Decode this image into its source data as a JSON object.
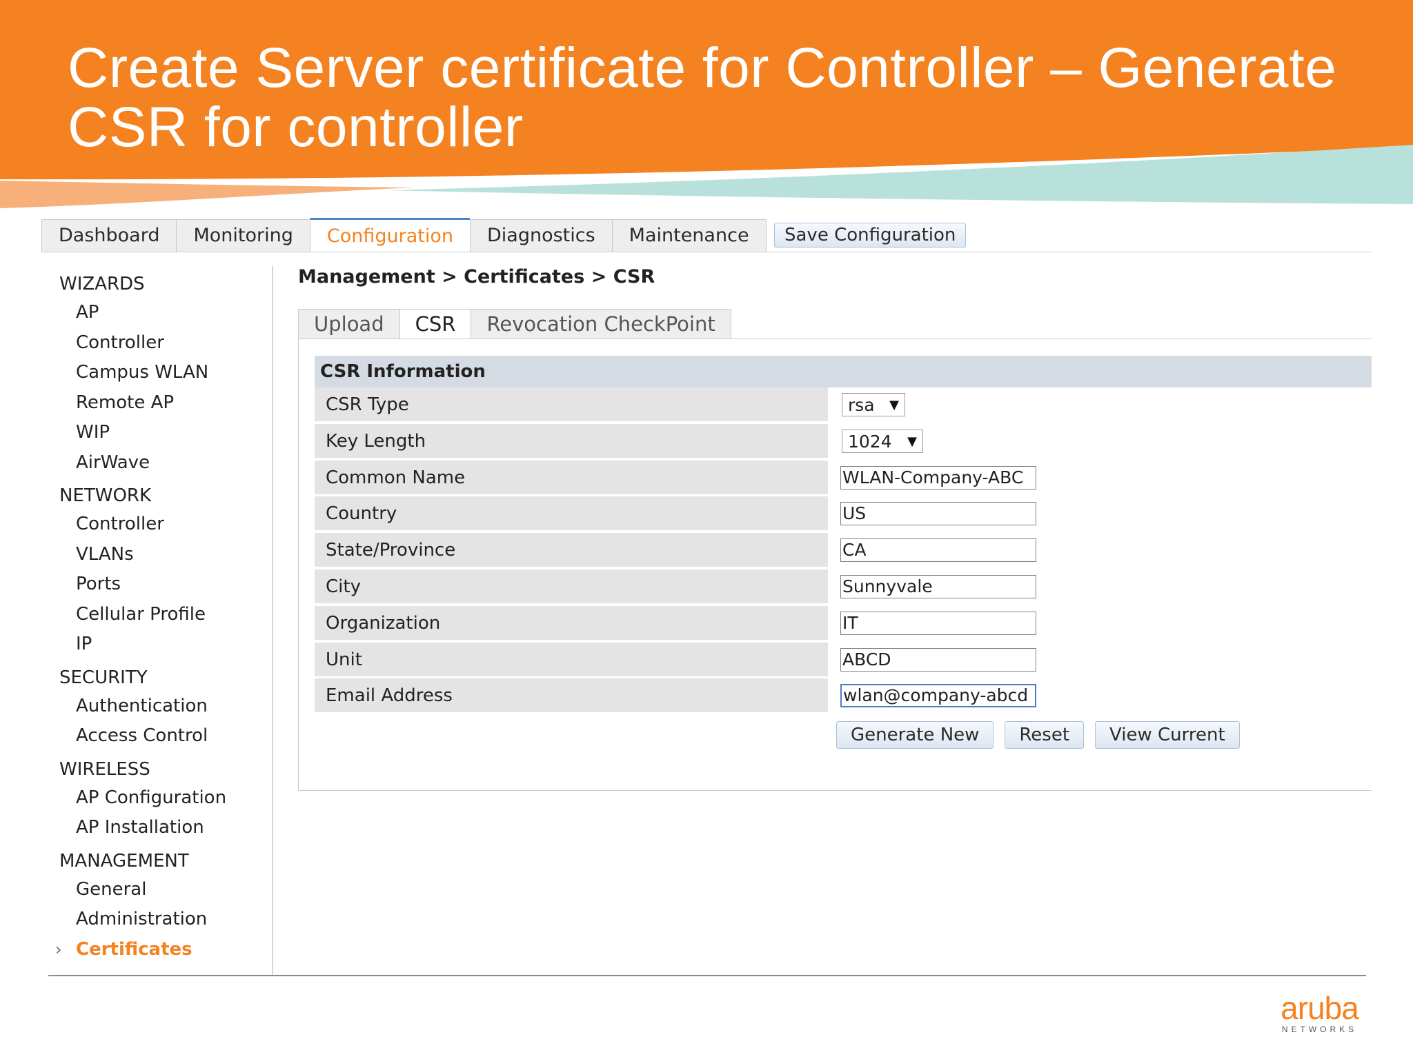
{
  "slide": {
    "title": "Create Server certificate for Controller – Generate CSR for controller"
  },
  "topnav": {
    "tabs": [
      "Dashboard",
      "Monitoring",
      "Configuration",
      "Diagnostics",
      "Maintenance"
    ],
    "active": "Configuration",
    "save_label": "Save Configuration"
  },
  "sidebar": {
    "sections": [
      {
        "title": "WIZARDS",
        "items": [
          "AP",
          "Controller",
          "Campus WLAN",
          "Remote AP",
          "WIP",
          "AirWave"
        ]
      },
      {
        "title": "NETWORK",
        "items": [
          "Controller",
          "VLANs",
          "Ports",
          "Cellular Profile",
          "IP"
        ]
      },
      {
        "title": "SECURITY",
        "items": [
          "Authentication",
          "Access Control"
        ]
      },
      {
        "title": "WIRELESS",
        "items": [
          "AP Configuration",
          "AP Installation"
        ]
      },
      {
        "title": "MANAGEMENT",
        "items": [
          "General",
          "Administration",
          "Certificates"
        ]
      }
    ],
    "active_item": "Certificates",
    "active_marker": "›"
  },
  "breadcrumb": "Management > Certificates > CSR",
  "subtabs": {
    "items": [
      "Upload",
      "CSR",
      "Revocation CheckPoint"
    ],
    "active": "CSR"
  },
  "csr": {
    "header": "CSR Information",
    "fields": [
      {
        "label": "CSR Type",
        "kind": "select",
        "value": "rsa"
      },
      {
        "label": "Key Length",
        "kind": "select",
        "value": "1024"
      },
      {
        "label": "Common Name",
        "kind": "input",
        "value": "WLAN-Company-ABC"
      },
      {
        "label": "Country",
        "kind": "input",
        "value": "US"
      },
      {
        "label": "State/Province",
        "kind": "input",
        "value": "CA"
      },
      {
        "label": "City",
        "kind": "input",
        "value": "Sunnyvale"
      },
      {
        "label": "Organization",
        "kind": "input",
        "value": "IT"
      },
      {
        "label": "Unit",
        "kind": "input",
        "value": "ABCD"
      },
      {
        "label": "Email Address",
        "kind": "input",
        "value": "wlan@company-abcd"
      }
    ],
    "focused_field": "Email Address",
    "dropdown_glyph": "▼",
    "buttons": [
      "Generate New",
      "Reset",
      "View Current"
    ]
  },
  "logo": {
    "word": "aruba",
    "tagline": "NETWORKS"
  },
  "colors": {
    "orange": "#F58220",
    "active_tab_text": "#F58220",
    "header_band": "#D5DBE3",
    "teal_stripe": "#B9E1DC"
  }
}
